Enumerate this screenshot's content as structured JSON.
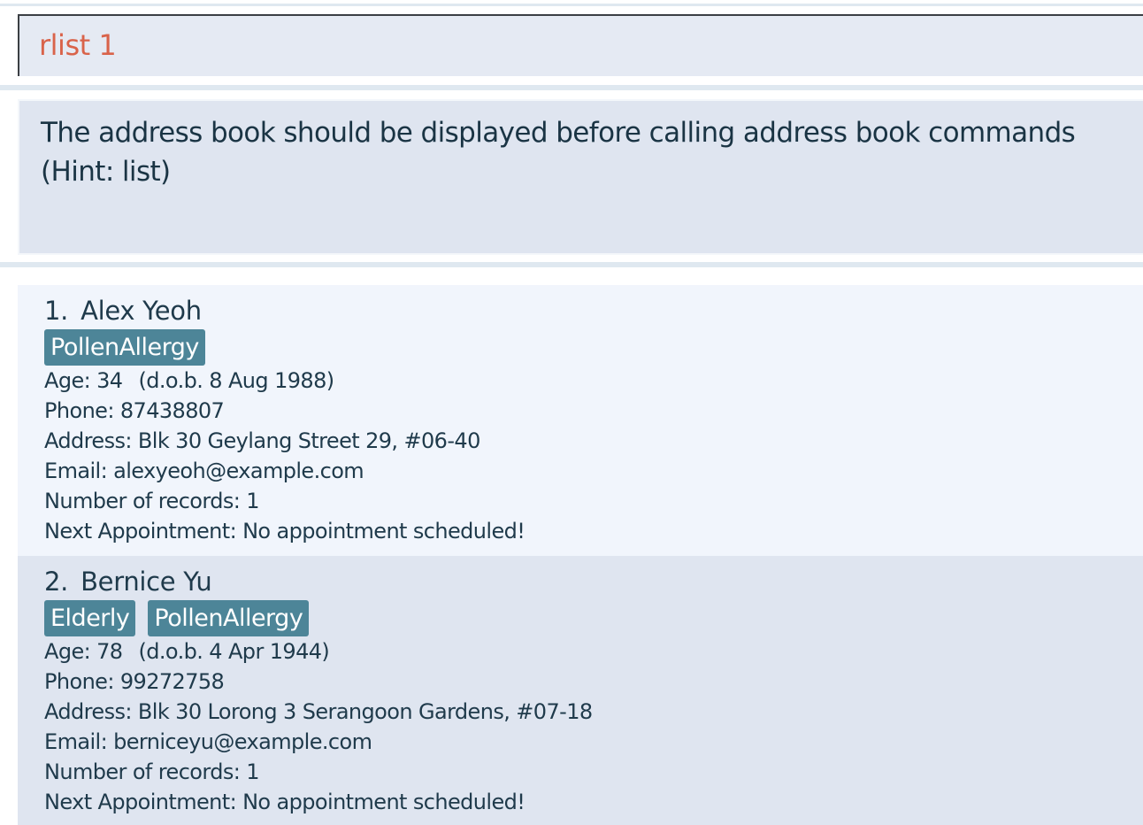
{
  "command_box": {
    "value": "rlist 1"
  },
  "result_display": {
    "message_line1": "The address book should be displayed before calling address book commands",
    "message_line2": "(Hint: list)"
  },
  "persons": [
    {
      "index": "1.",
      "name": "Alex Yeoh",
      "tags": [
        "PollenAllergy"
      ],
      "age": "Age: 34",
      "dob": "(d.o.b. 8 Aug 1988)",
      "phone": "Phone: 87438807",
      "address": "Address: Blk 30 Geylang Street 29, #06-40",
      "email": "Email: alexyeoh@example.com",
      "records": "Number of records: 1",
      "appointment": "Next Appointment: No appointment scheduled!"
    },
    {
      "index": "2.",
      "name": "Bernice Yu",
      "tags": [
        "Elderly",
        "PollenAllergy"
      ],
      "age": "Age: 78",
      "dob": "(d.o.b. 4 Apr 1944)",
      "phone": "Phone: 99272758",
      "address": "Address: Blk 30 Lorong 3 Serangoon Gardens, #07-18",
      "email": "Email: berniceyu@example.com",
      "records": "Number of records: 1",
      "appointment": "Next Appointment: No appointment scheduled!"
    }
  ],
  "colors": {
    "command_text": "#d9634a",
    "tag_background": "#4d8598",
    "card_odd": "#f1f5fc",
    "card_even": "#dfe5f0"
  }
}
